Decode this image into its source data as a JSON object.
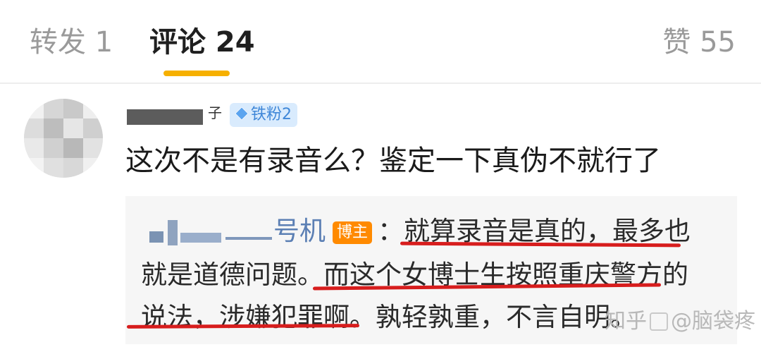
{
  "tabs": {
    "repost": "转发 1",
    "comments": "评论 24",
    "likes": "赞 55"
  },
  "comment": {
    "username_tail": "子",
    "fan_badge": "铁粉2",
    "text": "这次不是有录音么？鉴定一下真伪不就行了"
  },
  "reply": {
    "name_suffix": "号机",
    "op_badge": "博主",
    "line1": "：就算录音是真的，最多也",
    "line2": "就是道德问题。而这个女博士生按照重庆警方的",
    "line3": "说法，涉嫌犯罪啊。孰轻孰重，不言自明。"
  },
  "watermark": {
    "site": "知乎",
    "author": "@脑袋疼"
  },
  "colors": {
    "accent": "#f6b000",
    "underline": "#d71d1d",
    "op_badge": "#ff8a00",
    "fan_badge_bg": "#d9ebfd",
    "link": "#5b7fb4"
  }
}
